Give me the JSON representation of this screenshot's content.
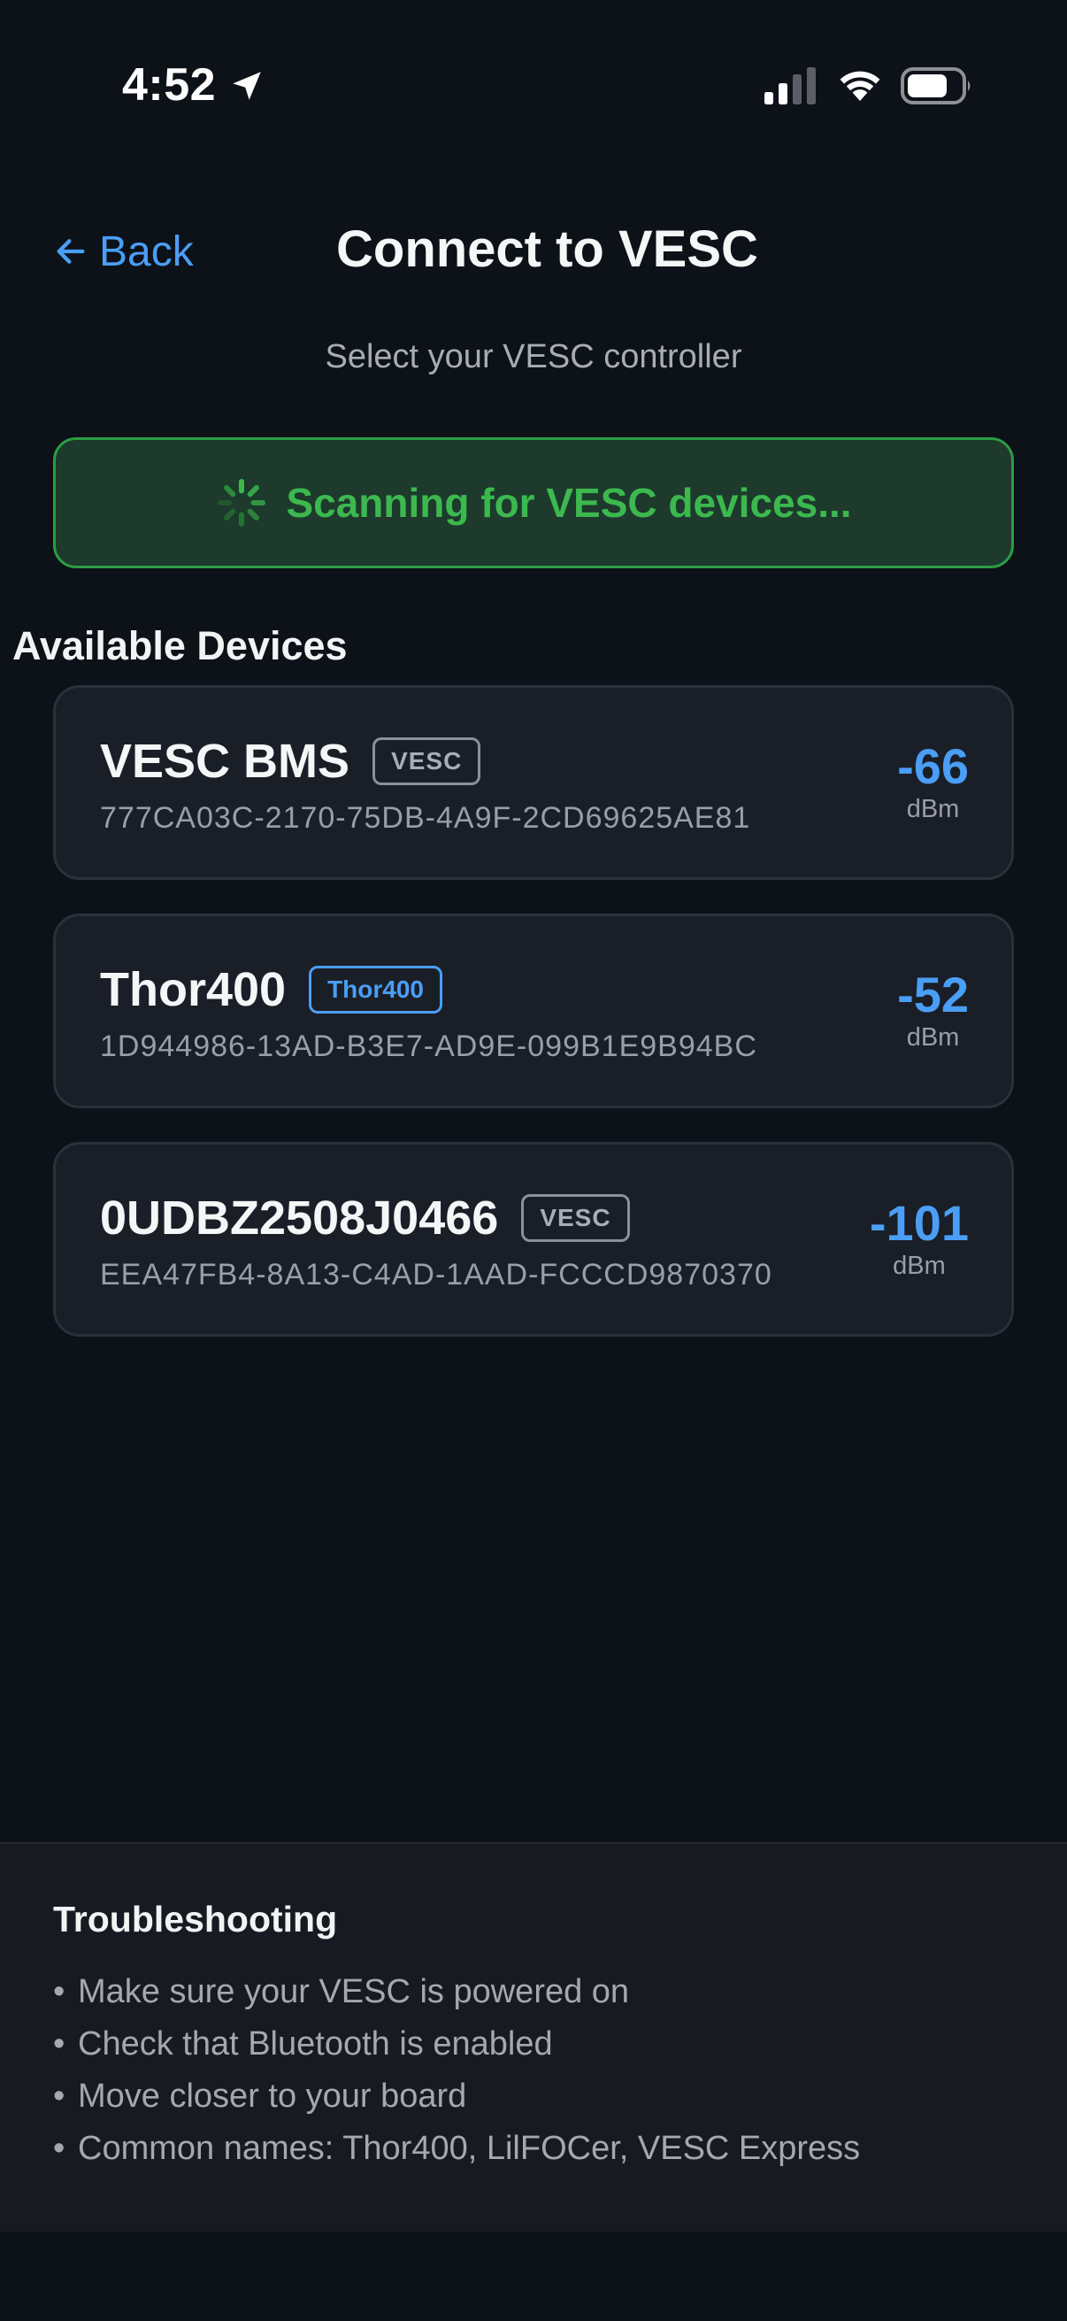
{
  "status_bar": {
    "time": "4:52",
    "icons": [
      "location-arrow-icon",
      "cellular-signal-icon",
      "wifi-icon",
      "battery-icon"
    ]
  },
  "header": {
    "back_label": "Back",
    "title": "Connect to VESC",
    "subtitle": "Select your VESC controller"
  },
  "scan": {
    "text": "Scanning for VESC devices...",
    "icon": "spinner-icon"
  },
  "devices_section": {
    "title": "Available Devices",
    "devices": [
      {
        "name": "VESC BMS",
        "badge": "VESC",
        "id": "777CA03C-2170-75DB-4A9F-2CD69625AE81",
        "rssi": "-66",
        "unit": "dBm"
      },
      {
        "name": "Thor400",
        "badge": "Thor400",
        "id": "1D944986-13AD-B3E7-AD9E-099B1E9B94BC",
        "rssi": "-52",
        "unit": "dBm"
      },
      {
        "name": "0UDBZ2508J0466",
        "badge": "VESC",
        "id": "EEA47FB4-8A13-C4AD-1AAD-FCCCD9870370",
        "rssi": "-101",
        "unit": "dBm"
      }
    ]
  },
  "troubleshooting": {
    "title": "Troubleshooting",
    "bullet": "•",
    "items": [
      "Make sure your VESC is powered on",
      "Check that Bluetooth is enabled",
      "Move closer to your board",
      "Common names: Thor400, LilFOCer, VESC Express"
    ]
  },
  "colors": {
    "background": "#0d1118",
    "accent": "#4a9ef7",
    "scan_green": "#3cb84f",
    "scan_bg": "#1d3a2c",
    "card_bg": "#1a1e27"
  }
}
